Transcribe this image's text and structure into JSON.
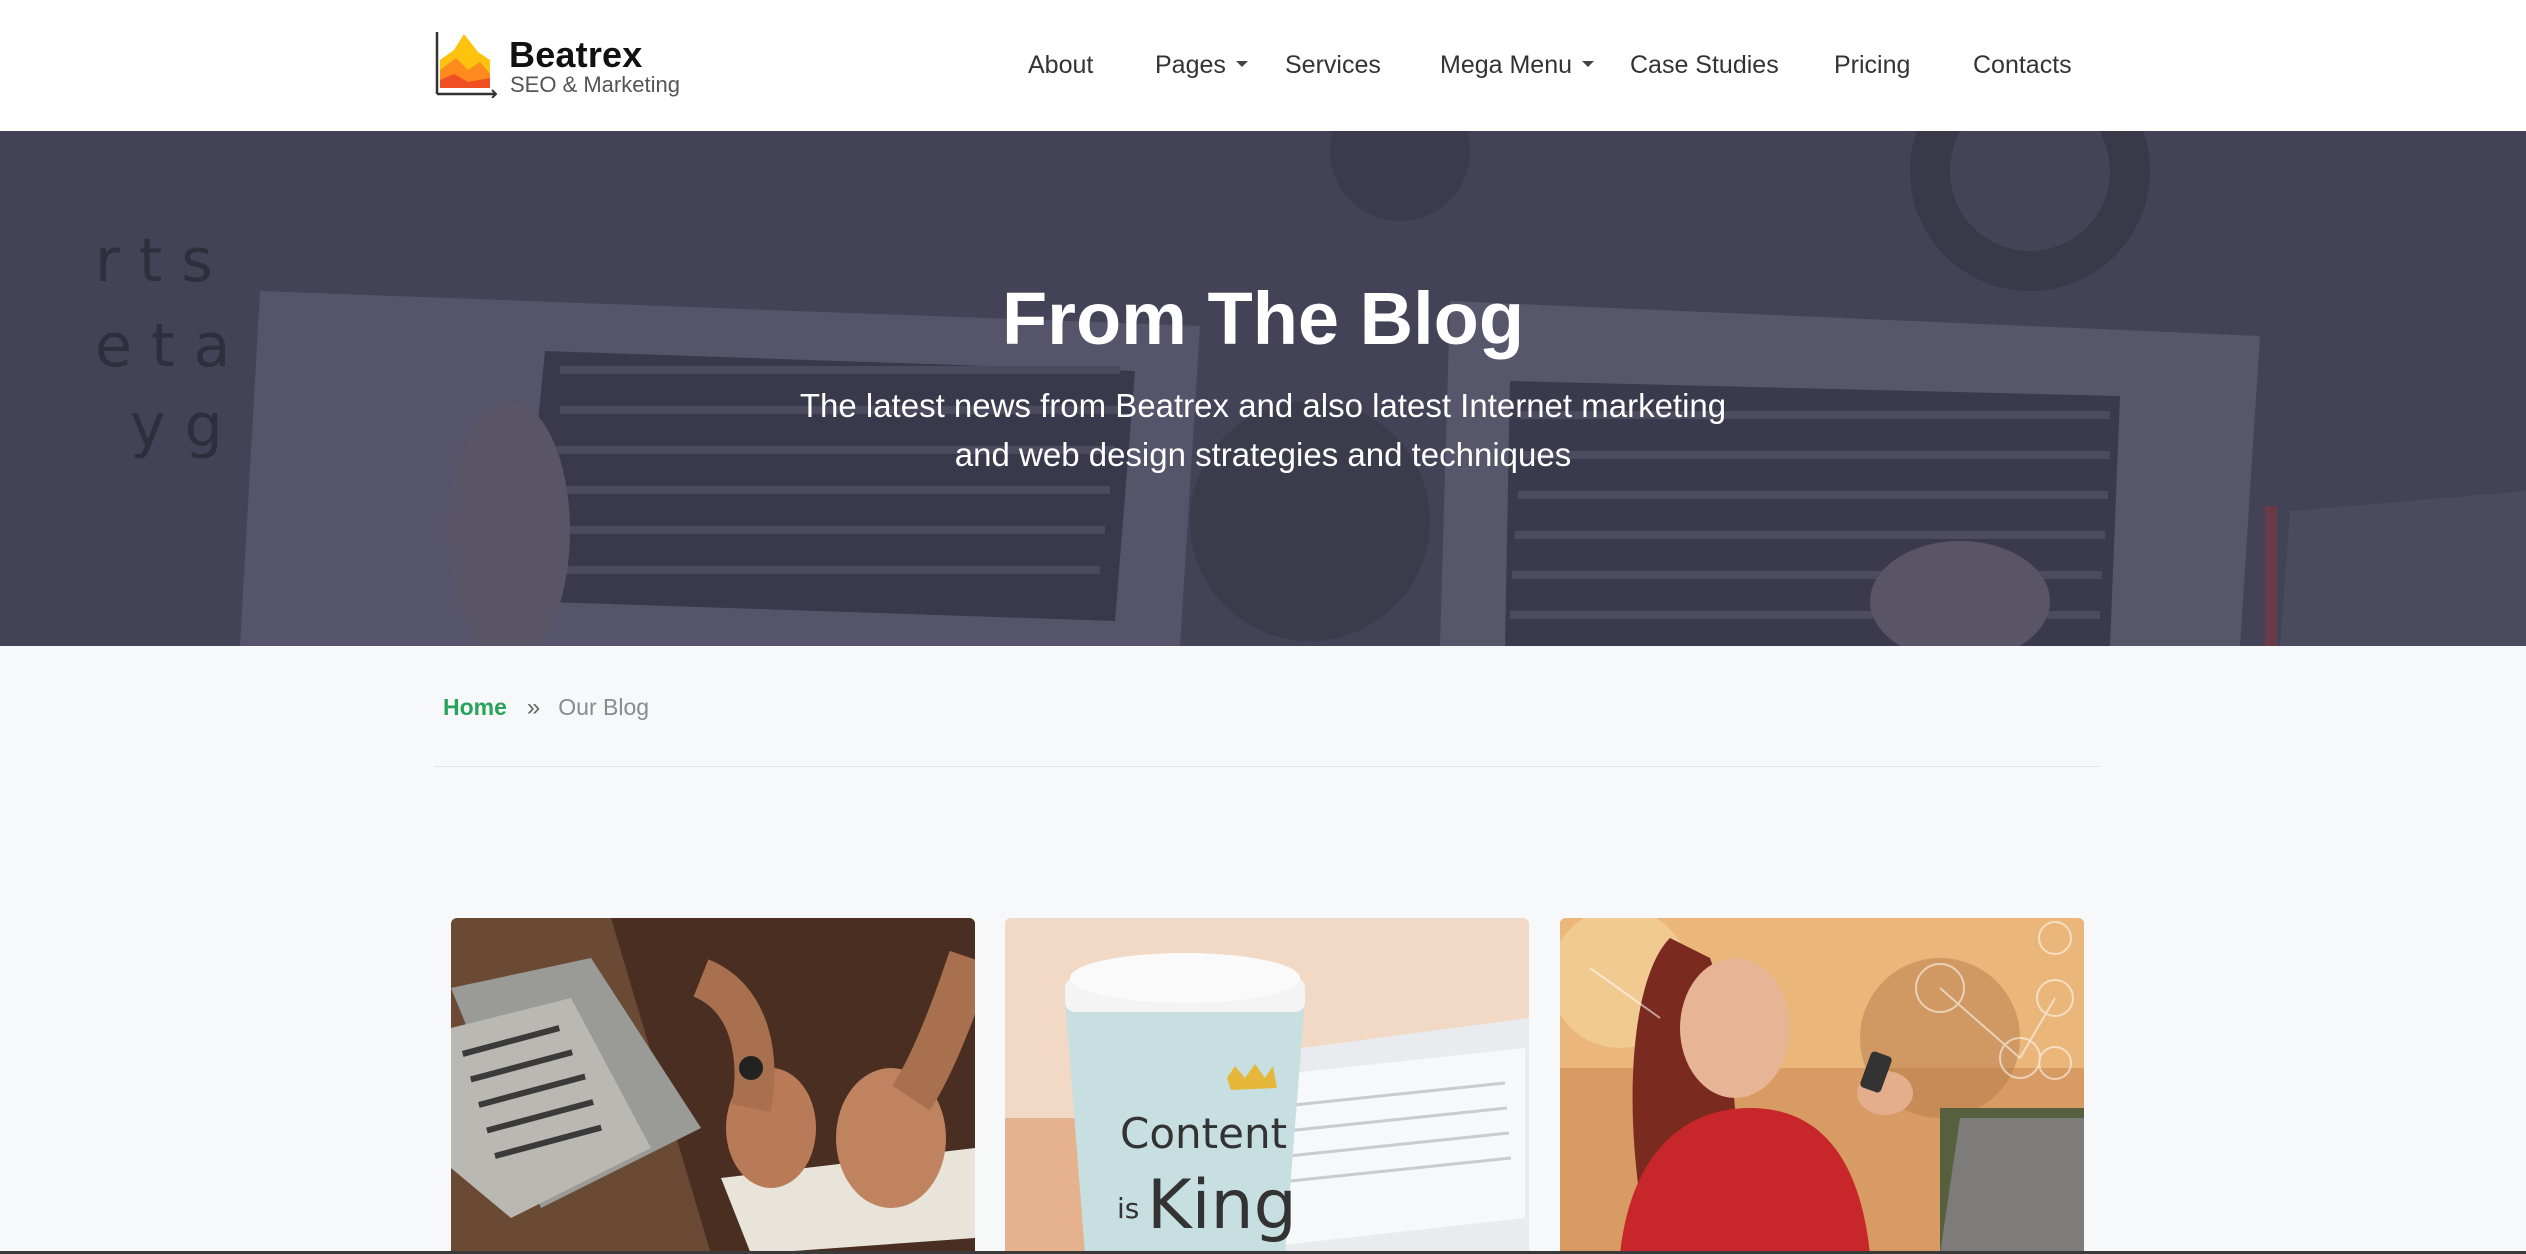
{
  "brand": {
    "name": "Beatrex",
    "tagline": "SEO & Marketing",
    "colors": {
      "primary": "#2aa35a",
      "logo_orange": "#ff8a1e",
      "logo_yellow": "#ffc20e",
      "logo_red": "#f04e23"
    }
  },
  "nav": {
    "items": [
      {
        "label": "About",
        "has_dropdown": false
      },
      {
        "label": "Pages",
        "has_dropdown": true
      },
      {
        "label": "Services",
        "has_dropdown": false
      },
      {
        "label": "Mega Menu",
        "has_dropdown": true
      },
      {
        "label": "Case Studies",
        "has_dropdown": false
      },
      {
        "label": "Pricing",
        "has_dropdown": false
      },
      {
        "label": "Contacts",
        "has_dropdown": false
      }
    ]
  },
  "hero": {
    "title": "From The Blog",
    "subtitle_line1": "The latest news from Beatrex and also latest Internet marketing",
    "subtitle_line2": "and web design strategies and techniques",
    "background_icon": "laptops-desk-photo"
  },
  "breadcrumb": {
    "home": "Home",
    "separator": "»",
    "current": "Our Blog"
  },
  "posts": [
    {
      "image": "hands-typing-on-laptop-photo"
    },
    {
      "image": "content-is-king-coffee-cup-photo",
      "cup_line1": "Content",
      "cup_line2_small": "is",
      "cup_line2_big": "King"
    },
    {
      "image": "woman-with-smartphone-photo"
    }
  ]
}
